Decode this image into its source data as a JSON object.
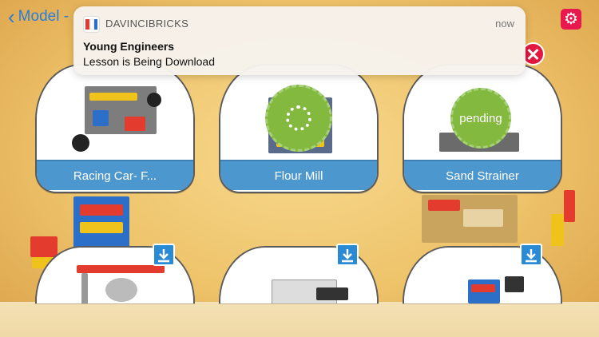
{
  "nav": {
    "back_label": "Model -"
  },
  "notification": {
    "app_name": "DAVINCIBRICKS",
    "time": "now",
    "title": "Young Engineers",
    "body": "Lesson is Being Download"
  },
  "cards": [
    {
      "label": "Racing Car- F...",
      "status": ""
    },
    {
      "label": "Flour Mill",
      "status": "downloading"
    },
    {
      "label": "Sand Strainer",
      "status": "pending"
    }
  ],
  "pending_text": "pending",
  "colors": {
    "accent_blue": "#4d97cf",
    "settings_red": "#e8194c",
    "progress_green": "#83b93e"
  },
  "icons": [
    "chevron-left-icon",
    "gear-icon",
    "close-icon",
    "download-icon",
    "spinner-icon"
  ]
}
